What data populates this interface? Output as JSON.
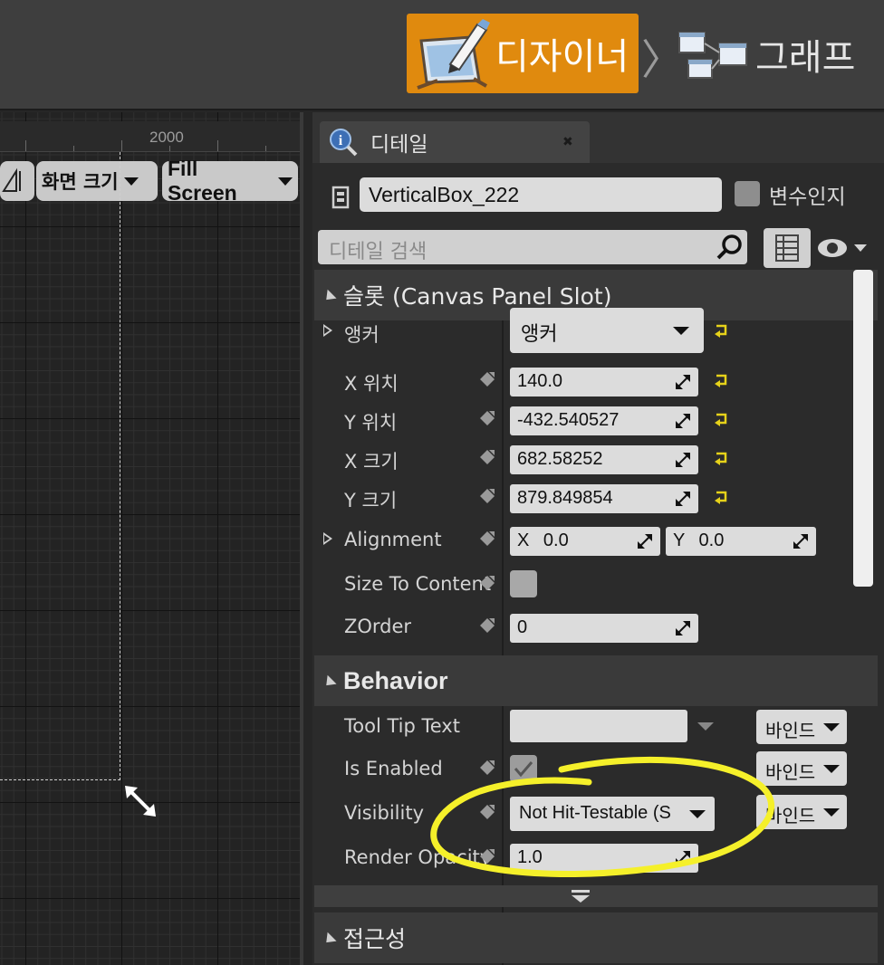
{
  "toolbar": {
    "designer_label": "디자이너",
    "graph_label": "그래프",
    "designer_icon": "designer-pencil-icon",
    "graph_icon": "graph-nodes-icon",
    "accent": "#e08a0e"
  },
  "viewport": {
    "ruler_label": "2000",
    "screen_size_label": "화면 크기",
    "fill_screen_label": "Fill Screen"
  },
  "details": {
    "tab_label": "디테일",
    "tab_icon": "info-search-icon",
    "name_value": "VerticalBox_222",
    "is_variable_label": "변수인지",
    "search_placeholder": "디테일 검색",
    "slot_section": "슬롯 (Canvas Panel Slot)",
    "anchor_label": "앵커",
    "anchor_value": "앵커",
    "x_pos_label": "X 위치",
    "x_pos_value": "140.0",
    "y_pos_label": "Y 위치",
    "y_pos_value": "-432.540527",
    "x_size_label": "X 크기",
    "x_size_value": "682.58252",
    "y_size_label": "Y 크기",
    "y_size_value": "879.849854",
    "alignment_label": "Alignment",
    "alignment_x_label": "X",
    "alignment_x_value": "0.0",
    "alignment_y_label": "Y",
    "alignment_y_value": "0.0",
    "size_to_content_label": "Size To Content",
    "zorder_label": "ZOrder",
    "zorder_value": "0",
    "behavior_section": "Behavior",
    "tooltip_label": "Tool Tip Text",
    "tooltip_value": "",
    "bind_label": "바인드",
    "is_enabled_label": "Is Enabled",
    "visibility_label": "Visibility",
    "visibility_value": "Not Hit-Testable (S",
    "render_opacity_label": "Render Opacity",
    "render_opacity_value": "1.0",
    "accessibility_section": "접근성",
    "annotation_color": "#f5f02a"
  }
}
